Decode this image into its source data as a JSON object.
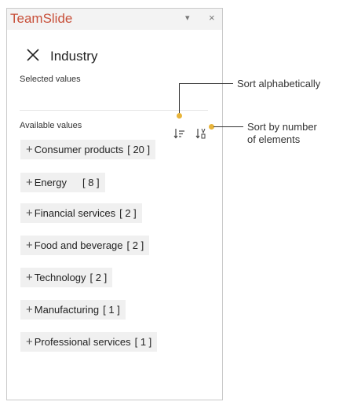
{
  "app": {
    "title": "TeamSlide",
    "menu_glyph": "▾",
    "close_glyph": "×"
  },
  "panel": {
    "title": "Industry",
    "selected_label": "Selected values",
    "available_label": "Available values"
  },
  "items": [
    {
      "label": "Consumer products",
      "count": "[ 20 ]"
    },
    {
      "label": "Energy",
      "count": "[ 8 ]"
    },
    {
      "label": "Financial services",
      "count": "[ 2 ]"
    },
    {
      "label": "Food and beverage",
      "count": "[ 2 ]"
    },
    {
      "label": "Technology",
      "count": "[ 2 ]"
    },
    {
      "label": "Manufacturing",
      "count": "[ 1 ]"
    },
    {
      "label": "Professional services",
      "count": "[ 1 ]"
    }
  ],
  "callouts": {
    "sort_alpha": "Sort alphabetically",
    "sort_number_line1": "Sort by number",
    "sort_number_line2": "of elements"
  },
  "colors": {
    "brand": "#c8503a",
    "callout_dot": "#e8b43a",
    "chip_bg": "#f0f0f0"
  }
}
